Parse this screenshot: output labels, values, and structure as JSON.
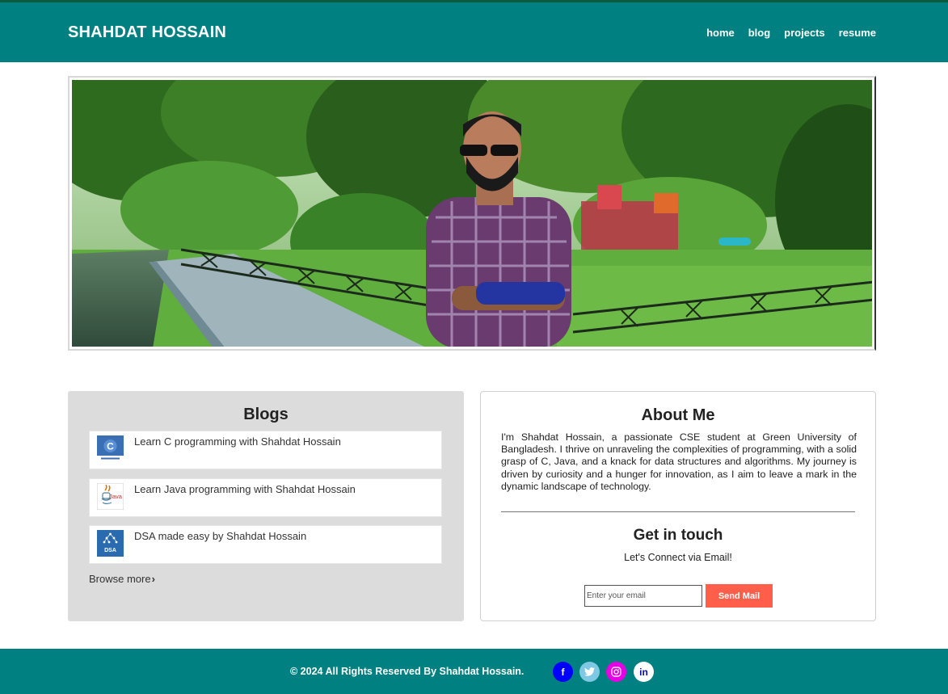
{
  "header": {
    "brand": "SHAHDAT HOSSAIN",
    "nav": [
      "home",
      "blog",
      "projects",
      "resume"
    ]
  },
  "hero": {
    "alt": "Shahdat Hossain standing in a park"
  },
  "blogs": {
    "title": "Blogs",
    "items": [
      {
        "title": "Learn C programming with Shahdat Hossain",
        "icon": "c-logo-icon"
      },
      {
        "title": "Learn Java programming with Shahdat Hossain",
        "icon": "java-logo-icon"
      },
      {
        "title": "DSA made easy by Shahdat Hossain",
        "icon": "dsa-logo-icon"
      }
    ],
    "browse_more": "Browse more"
  },
  "about": {
    "title": "About Me",
    "text": "I'm Shahdat Hossain, a passionate CSE student at Green University of Bangladesh. I thrive on unraveling the complexities of programming, with a solid grasp of C, Java, and a knack for data structures and algorithms. My journey is driven by curiosity and a hunger for innovation, as I aim to leave a mark in the dynamic landscape of technology.",
    "get_in_touch": "Get in touch",
    "connect_text": "Let's Connect via Email!",
    "email_placeholder": "Enter your email",
    "send_label": "Send Mail"
  },
  "footer": {
    "copyright": "© 2024 All Rights Reserved By Shahdat Hossain.",
    "social": [
      {
        "name": "facebook-icon",
        "glyph": "f",
        "bg": "#0000ff",
        "fg": "#ffffff"
      },
      {
        "name": "twitter-icon",
        "glyph": "🐦",
        "bg": "#7ec8e3",
        "fg": "#ffffff"
      },
      {
        "name": "instagram-icon",
        "glyph": "◎",
        "bg": "#e600e6",
        "fg": "#ffffff"
      },
      {
        "name": "linkedin-icon",
        "glyph": "in",
        "bg": "#ffffff",
        "fg": "#0a0aa8"
      }
    ]
  },
  "colors": {
    "primary": "#008080",
    "accent": "#ff5f4a",
    "card_bg": "#dcdcdc"
  }
}
